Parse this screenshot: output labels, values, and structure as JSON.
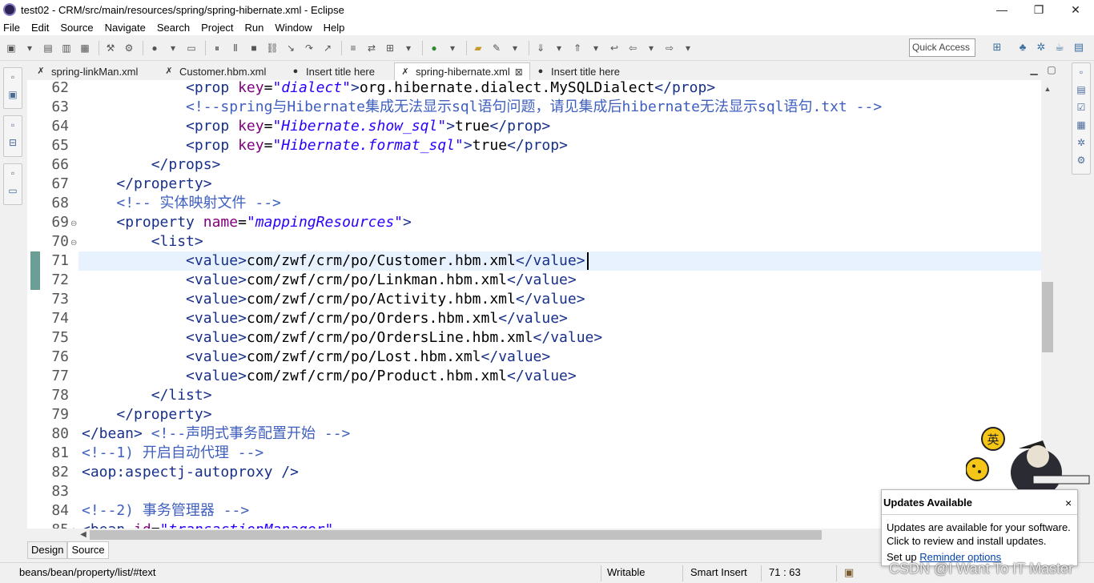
{
  "window": {
    "title": "test02 - CRM/src/main/resources/spring/spring-hibernate.xml - Eclipse"
  },
  "menu": [
    "File",
    "Edit",
    "Source",
    "Navigate",
    "Search",
    "Project",
    "Run",
    "Window",
    "Help"
  ],
  "toolbar": {
    "quick_access_placeholder": "Quick Access"
  },
  "tabs": [
    {
      "label": "spring-linkMan.xml",
      "icon": "xml-file-icon"
    },
    {
      "label": "Customer.hbm.xml",
      "icon": "xml-file-icon"
    },
    {
      "label": "Insert title here",
      "icon": "globe-icon"
    },
    {
      "label": "spring-hibernate.xml",
      "icon": "xml-file-icon",
      "active": true
    },
    {
      "label": "Insert title here",
      "icon": "globe-icon"
    }
  ],
  "editor": {
    "lines": [
      {
        "n": "62",
        "fold": "",
        "spans": [
          [
            "ind",
            "            "
          ],
          [
            "tag",
            "<prop "
          ],
          [
            "attr",
            "key"
          ],
          [
            "txt",
            "="
          ],
          [
            "val",
            "\"dialect\""
          ],
          [
            "tag",
            ">"
          ],
          [
            "txt",
            "org.hibernate.dialect.MySQLDialect"
          ],
          [
            "tag",
            "</prop>"
          ]
        ]
      },
      {
        "n": "63",
        "fold": "",
        "spans": [
          [
            "ind",
            "            "
          ],
          [
            "com",
            "<!--spring与Hibernate集成无法显示sql语句问题，请见集成后hibernate无法显示sql语句.txt -->"
          ]
        ]
      },
      {
        "n": "64",
        "fold": "",
        "spans": [
          [
            "ind",
            "            "
          ],
          [
            "tag",
            "<prop "
          ],
          [
            "attr",
            "key"
          ],
          [
            "txt",
            "="
          ],
          [
            "val",
            "\"Hibernate.show_sql\""
          ],
          [
            "tag",
            ">"
          ],
          [
            "txt",
            "true"
          ],
          [
            "tag",
            "</prop>"
          ]
        ]
      },
      {
        "n": "65",
        "fold": "",
        "spans": [
          [
            "ind",
            "            "
          ],
          [
            "tag",
            "<prop "
          ],
          [
            "attr",
            "key"
          ],
          [
            "txt",
            "="
          ],
          [
            "val",
            "\"Hibernate.format_sql\""
          ],
          [
            "tag",
            ">"
          ],
          [
            "txt",
            "true"
          ],
          [
            "tag",
            "</prop>"
          ]
        ]
      },
      {
        "n": "66",
        "fold": "",
        "spans": [
          [
            "ind",
            "        "
          ],
          [
            "tag",
            "</props>"
          ]
        ]
      },
      {
        "n": "67",
        "fold": "",
        "spans": [
          [
            "ind",
            "    "
          ],
          [
            "tag",
            "</property>"
          ]
        ]
      },
      {
        "n": "68",
        "fold": "",
        "spans": [
          [
            "ind",
            "    "
          ],
          [
            "com",
            "<!-- 实体映射文件 -->"
          ]
        ]
      },
      {
        "n": "69",
        "fold": "⊖",
        "spans": [
          [
            "ind",
            "    "
          ],
          [
            "tag",
            "<property "
          ],
          [
            "attr",
            "name"
          ],
          [
            "txt",
            "="
          ],
          [
            "val",
            "\"mappingResources\""
          ],
          [
            "tag",
            ">"
          ]
        ]
      },
      {
        "n": "70",
        "fold": "⊖",
        "spans": [
          [
            "ind",
            "        "
          ],
          [
            "tag",
            "<list>"
          ]
        ]
      },
      {
        "n": "71",
        "fold": "",
        "spans": [
          [
            "ind",
            "            "
          ],
          [
            "tag",
            "<value>"
          ],
          [
            "txt",
            "com/zwf/crm/po/Customer.hbm.xml"
          ],
          [
            "tag",
            "</value>"
          ]
        ]
      },
      {
        "n": "72",
        "fold": "",
        "spans": [
          [
            "ind",
            "            "
          ],
          [
            "tag",
            "<value>"
          ],
          [
            "txt",
            "com/zwf/crm/po/Linkman.hbm.xml"
          ],
          [
            "tag",
            "</value>"
          ]
        ]
      },
      {
        "n": "73",
        "fold": "",
        "spans": [
          [
            "ind",
            "            "
          ],
          [
            "tag",
            "<value>"
          ],
          [
            "txt",
            "com/zwf/crm/po/Activity.hbm.xml"
          ],
          [
            "tag",
            "</value>"
          ]
        ]
      },
      {
        "n": "74",
        "fold": "",
        "spans": [
          [
            "ind",
            "            "
          ],
          [
            "tag",
            "<value>"
          ],
          [
            "txt",
            "com/zwf/crm/po/Orders.hbm.xml"
          ],
          [
            "tag",
            "</value>"
          ]
        ]
      },
      {
        "n": "75",
        "fold": "",
        "spans": [
          [
            "ind",
            "            "
          ],
          [
            "tag",
            "<value>"
          ],
          [
            "txt",
            "com/zwf/crm/po/OrdersLine.hbm.xml"
          ],
          [
            "tag",
            "</value>"
          ]
        ]
      },
      {
        "n": "76",
        "fold": "",
        "spans": [
          [
            "ind",
            "            "
          ],
          [
            "tag",
            "<value>"
          ],
          [
            "txt",
            "com/zwf/crm/po/Lost.hbm.xml"
          ],
          [
            "tag",
            "</value>"
          ]
        ]
      },
      {
        "n": "77",
        "fold": "",
        "spans": [
          [
            "ind",
            "            "
          ],
          [
            "tag",
            "<value>"
          ],
          [
            "txt",
            "com/zwf/crm/po/Product.hbm.xml"
          ],
          [
            "tag",
            "</value>"
          ]
        ]
      },
      {
        "n": "78",
        "fold": "",
        "spans": [
          [
            "ind",
            "        "
          ],
          [
            "tag",
            "</list>"
          ]
        ]
      },
      {
        "n": "79",
        "fold": "",
        "spans": [
          [
            "ind",
            "    "
          ],
          [
            "tag",
            "</property>"
          ]
        ]
      },
      {
        "n": "80",
        "fold": "",
        "spans": [
          [
            "tag",
            "</bean> "
          ],
          [
            "com",
            "<!--声明式事务配置开始 -->"
          ]
        ]
      },
      {
        "n": "81",
        "fold": "",
        "spans": [
          [
            "com",
            "<!--1) 开启自动代理 -->"
          ]
        ]
      },
      {
        "n": "82",
        "fold": "",
        "spans": [
          [
            "tag",
            "<aop:aspectj-autoproxy />"
          ]
        ]
      },
      {
        "n": "83",
        "fold": "",
        "spans": []
      },
      {
        "n": "84",
        "fold": "",
        "spans": [
          [
            "com",
            "<!--2) 事务管理器 -->"
          ]
        ]
      },
      {
        "n": "85",
        "fold": "⊖",
        "spans": [
          [
            "tag",
            "<bean "
          ],
          [
            "attr",
            "id"
          ],
          [
            "txt",
            "="
          ],
          [
            "val",
            "\"transactionManager\""
          ]
        ]
      }
    ]
  },
  "bottom_tabs": [
    {
      "label": "Design"
    },
    {
      "label": "Source",
      "active": true
    }
  ],
  "status": {
    "path": "beans/bean/property/list/#text",
    "mode": "Writable",
    "insert": "Smart Insert",
    "position": "71 : 63"
  },
  "notification": {
    "title": "Updates Available",
    "close": "×",
    "body_line1": "Updates are available for your software.",
    "body_line2": "Click to review and install updates.",
    "footer_prefix": "Set up ",
    "footer_link": "Reminder options"
  },
  "ime_badge": "英",
  "watermark": "CSDN @I Want To IT Master"
}
